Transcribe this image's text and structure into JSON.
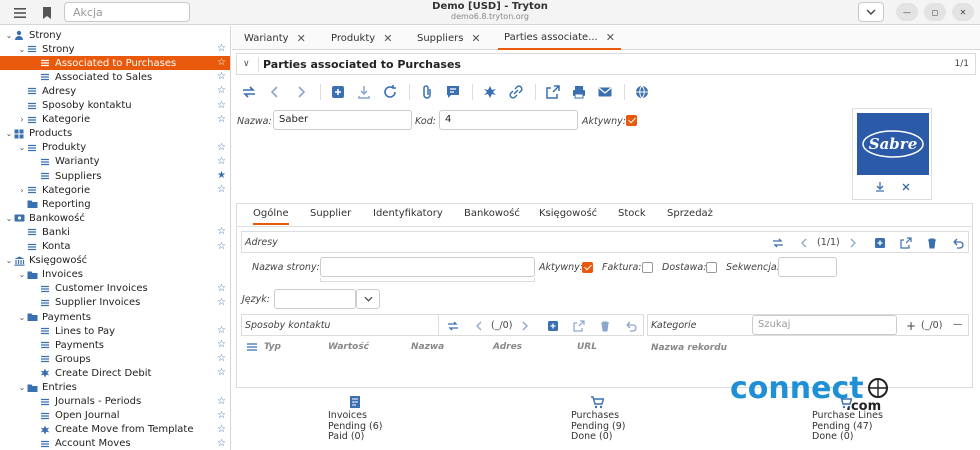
{
  "window": {
    "title": "Demo [USD] - Tryton",
    "subtitle": "demo6.8.tryton.org"
  },
  "search": {
    "placeholder": "Akcja"
  },
  "sidebar": {
    "items": [
      {
        "label": "Strony",
        "level": 0,
        "exp": "v",
        "icon": "user-icon",
        "star": ""
      },
      {
        "label": "Strony",
        "level": 1,
        "exp": "v",
        "icon": "list-icon",
        "star": "☆"
      },
      {
        "label": "Associated to Purchases",
        "level": 2,
        "exp": "",
        "icon": "list-icon",
        "star": "☆",
        "selected": true
      },
      {
        "label": "Associated to Sales",
        "level": 2,
        "exp": "",
        "icon": "list-icon",
        "star": "☆"
      },
      {
        "label": "Adresy",
        "level": 1,
        "exp": "",
        "icon": "list-icon",
        "star": "☆"
      },
      {
        "label": "Sposoby kontaktu",
        "level": 1,
        "exp": "",
        "icon": "list-icon",
        "star": "☆"
      },
      {
        "label": "Kategorie",
        "level": 1,
        "exp": ">",
        "icon": "list-icon",
        "star": "☆"
      },
      {
        "label": "Products",
        "level": 0,
        "exp": "v",
        "icon": "grid-icon",
        "star": ""
      },
      {
        "label": "Produkty",
        "level": 1,
        "exp": "v",
        "icon": "list-icon",
        "star": "☆"
      },
      {
        "label": "Warianty",
        "level": 2,
        "exp": "",
        "icon": "list-icon",
        "star": "☆"
      },
      {
        "label": "Suppliers",
        "level": 2,
        "exp": "",
        "icon": "list-icon",
        "star": "★"
      },
      {
        "label": "Kategorie",
        "level": 1,
        "exp": ">",
        "icon": "list-icon",
        "star": "☆"
      },
      {
        "label": "Reporting",
        "level": 1,
        "exp": "",
        "icon": "folder-icon",
        "star": ""
      },
      {
        "label": "Bankowość",
        "level": 0,
        "exp": "v",
        "icon": "bank-card-icon",
        "star": ""
      },
      {
        "label": "Banki",
        "level": 1,
        "exp": "",
        "icon": "list-icon",
        "star": "☆"
      },
      {
        "label": "Konta",
        "level": 1,
        "exp": "",
        "icon": "list-icon",
        "star": "☆"
      },
      {
        "label": "Księgowość",
        "level": 0,
        "exp": "v",
        "icon": "accounting-icon",
        "star": ""
      },
      {
        "label": "Invoices",
        "level": 1,
        "exp": "v",
        "icon": "folder-icon",
        "star": ""
      },
      {
        "label": "Customer Invoices",
        "level": 2,
        "exp": "",
        "icon": "list-icon",
        "star": "☆"
      },
      {
        "label": "Supplier Invoices",
        "level": 2,
        "exp": "",
        "icon": "list-icon",
        "star": "☆"
      },
      {
        "label": "Payments",
        "level": 1,
        "exp": "v",
        "icon": "folder-icon",
        "star": ""
      },
      {
        "label": "Lines to Pay",
        "level": 2,
        "exp": "",
        "icon": "list-icon",
        "star": "☆"
      },
      {
        "label": "Payments",
        "level": 2,
        "exp": "",
        "icon": "list-icon",
        "star": "☆"
      },
      {
        "label": "Groups",
        "level": 2,
        "exp": "",
        "icon": "list-icon",
        "star": "☆"
      },
      {
        "label": "Create Direct Debit",
        "level": 2,
        "exp": "",
        "icon": "wizard-icon",
        "star": "☆"
      },
      {
        "label": "Entries",
        "level": 1,
        "exp": "v",
        "icon": "folder-icon",
        "star": ""
      },
      {
        "label": "Journals - Periods",
        "level": 2,
        "exp": "",
        "icon": "list-icon",
        "star": "☆"
      },
      {
        "label": "Open Journal",
        "level": 2,
        "exp": "",
        "icon": "list-icon",
        "star": "☆"
      },
      {
        "label": "Create Move from Template",
        "level": 2,
        "exp": "",
        "icon": "wizard-icon",
        "star": "☆"
      },
      {
        "label": "Account Moves",
        "level": 2,
        "exp": "",
        "icon": "list-icon",
        "star": "☆"
      }
    ]
  },
  "tabs": [
    {
      "label": "Warianty"
    },
    {
      "label": "Produkty"
    },
    {
      "label": "Suppliers"
    },
    {
      "label": "Parties associate..."
    }
  ],
  "form": {
    "title": "Parties associated to Purchases",
    "record_count": "1/1",
    "name_label": "Nazwa:",
    "name_value": "Saber",
    "code_label": "Kod:",
    "code_value": "4",
    "active_label": "Aktywny:",
    "active_checked": true,
    "logo_text": "Sabre"
  },
  "notebook": {
    "tabs": [
      "Ogólne",
      "Supplier",
      "Identyfikatory",
      "Bankowość",
      "Księgowość",
      "Stock",
      "Sprzedaż"
    ],
    "addresses": {
      "label": "Adresy",
      "count": "(1/1)",
      "party_name_label": "Nazwa strony:",
      "active_label": "Aktywny:",
      "invoice_label": "Faktura:",
      "delivery_label": "Dostawa:",
      "sequence_label": "Sekwencja:"
    },
    "language_label": "Język:",
    "contacts": {
      "label": "Sposoby kontaktu",
      "count": "(_/0)",
      "columns": [
        "Typ",
        "Wartość",
        "Nazwa",
        "Adres",
        "URL"
      ]
    },
    "categories": {
      "label": "Kategorie",
      "search_placeholder": "Szukaj",
      "count": "(_/0)",
      "column": "Nazwa rekordu"
    }
  },
  "footer": [
    {
      "title": "Invoices",
      "line1": "Pending (6)",
      "line2": "Paid (0)",
      "icon": "invoice-icon"
    },
    {
      "title": "Purchases",
      "line1": "Pending (9)",
      "line2": "Done (0)",
      "icon": "cart-icon"
    },
    {
      "title": "Purchase Lines",
      "line1": "Pending (47)",
      "line2": "Done (0)",
      "icon": "cart-icon"
    }
  ],
  "watermark": {
    "text": "connect",
    "subtext": ".com"
  },
  "colors": {
    "accent": "#e8590c",
    "icon_blue": "#3a6fb0",
    "logo_bg": "#2b5aa8"
  }
}
